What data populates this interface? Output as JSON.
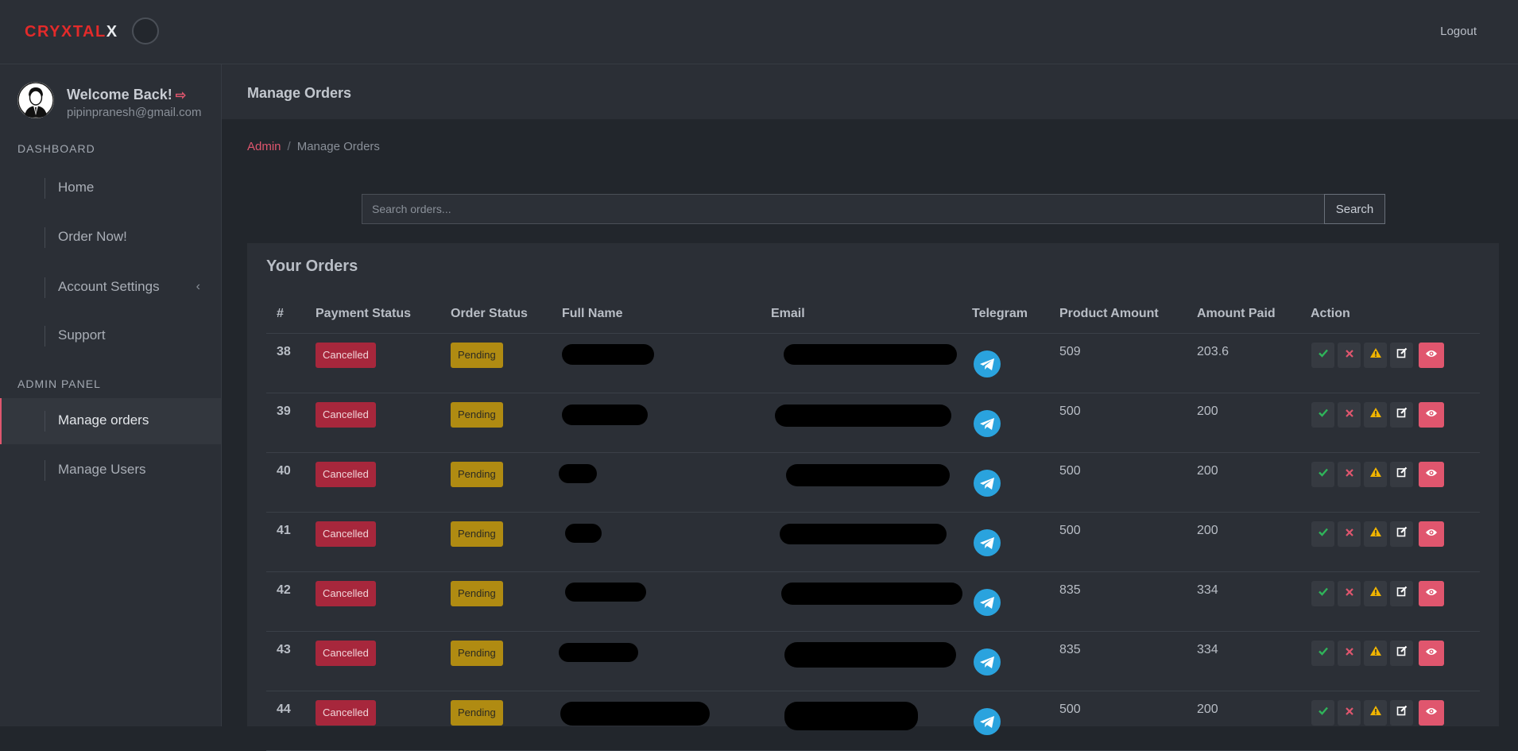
{
  "brand": {
    "part1": "CRYXTAL",
    "part2": "X",
    "accent": "#e32a2a"
  },
  "topbar": {
    "logout_label": "Logout"
  },
  "profile": {
    "greeting": "Welcome Back!",
    "email": "pipinpranesh@gmail.com"
  },
  "sidebar": {
    "sections": [
      {
        "heading": "DASHBOARD",
        "items": [
          "Home",
          "Order Now!",
          "Account Settings",
          "Support"
        ]
      },
      {
        "heading": "ADMIN PANEL",
        "items": [
          "Manage orders",
          "Manage Users"
        ]
      }
    ],
    "active_item": "Manage orders"
  },
  "page": {
    "title": "Manage Orders"
  },
  "breadcrumb": {
    "root": "Admin",
    "current": "Manage Orders"
  },
  "search": {
    "placeholder": "Search orders...",
    "button_label": "Search"
  },
  "orders": {
    "title": "Your Orders",
    "columns": [
      "#",
      "Payment Status",
      "Order Status",
      "Full Name",
      "Email",
      "Telegram",
      "Product Amount",
      "Amount Paid",
      "Action"
    ],
    "rows": [
      {
        "id": "38",
        "payment_status": "Cancelled",
        "order_status": "Pending",
        "product_amount": "509",
        "amount_paid": "203.6"
      },
      {
        "id": "39",
        "payment_status": "Cancelled",
        "order_status": "Pending",
        "product_amount": "500",
        "amount_paid": "200"
      },
      {
        "id": "40",
        "payment_status": "Cancelled",
        "order_status": "Pending",
        "product_amount": "500",
        "amount_paid": "200"
      },
      {
        "id": "41",
        "payment_status": "Cancelled",
        "order_status": "Pending",
        "product_amount": "500",
        "amount_paid": "200"
      },
      {
        "id": "42",
        "payment_status": "Cancelled",
        "order_status": "Pending",
        "product_amount": "835",
        "amount_paid": "334"
      },
      {
        "id": "43",
        "payment_status": "Cancelled",
        "order_status": "Pending",
        "product_amount": "835",
        "amount_paid": "334"
      },
      {
        "id": "44",
        "payment_status": "Cancelled",
        "order_status": "Pending",
        "product_amount": "500",
        "amount_paid": "200"
      }
    ],
    "row_actions": [
      "check-icon",
      "close-icon",
      "warning-icon",
      "edit-icon",
      "eye-icon"
    ]
  },
  "colors": {
    "accent_pink": "#e0566e",
    "cancelled": "#a7273c",
    "pending": "#b08b12",
    "telegram": "#2aa3de",
    "success": "#2fb45a",
    "danger": "#e0566e",
    "warning": "#f0b400"
  }
}
